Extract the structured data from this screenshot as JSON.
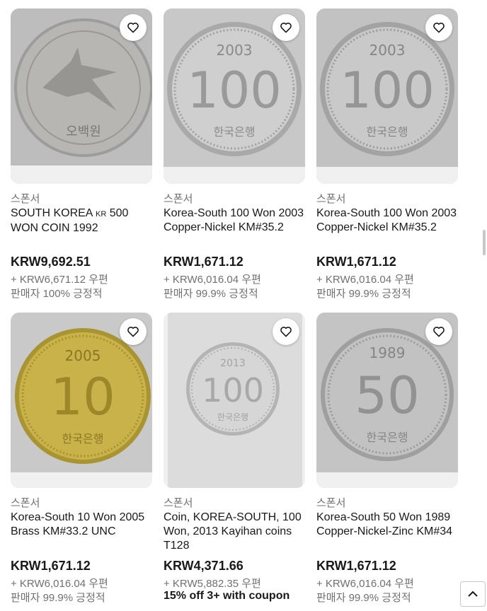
{
  "listings": [
    {
      "sponsored": "스폰서",
      "title_main": "SOUTH KOREA ",
      "title_kr": "KR",
      "title_rest": " 500 WON COIN 1992",
      "price": "KRW9,692.51",
      "shipping": "+ KRW6,671.12 우편",
      "seller": "판매자 100% 긍정적",
      "coin_label": "오백원",
      "wishlist_icon": "heart-icon"
    },
    {
      "sponsored": "스폰서",
      "title": "Korea-South 100 Won 2003 Copper-Nickel KM#35.2",
      "price": "KRW1,671.12",
      "shipping": "+ KRW6,016.04 우편",
      "seller": "판매자 99.9% 긍정적",
      "coin_year": "2003",
      "coin_value": "100",
      "coin_label": "한국은행",
      "wishlist_icon": "heart-icon"
    },
    {
      "sponsored": "스폰서",
      "title": "Korea-South 100 Won 2003 Copper-Nickel KM#35.2",
      "price": "KRW1,671.12",
      "shipping": "+ KRW6,016.04 우편",
      "seller": "판매자 99.9% 긍정적",
      "coin_year": "2003",
      "coin_value": "100",
      "coin_label": "한국은행",
      "wishlist_icon": "heart-icon"
    },
    {
      "sponsored": "스폰서",
      "title": "Korea-South 10 Won 2005 Brass KM#33.2 UNC",
      "price": "KRW1,671.12",
      "shipping": "+ KRW6,016.04 우편",
      "seller": "판매자 99.9% 긍정적",
      "coin_year": "2005",
      "coin_value": "10",
      "coin_label": "한국은행",
      "wishlist_icon": "heart-icon"
    },
    {
      "sponsored": "스폰서",
      "title": "Coin, KOREA-SOUTH, 100 Won, 2013 Kayihan coins T128",
      "price": "KRW4,371.66",
      "shipping": "+ KRW5,882.35 우편",
      "coupon": "15% off 3+ with coupon",
      "coin_year": "2013",
      "coin_value": "100",
      "coin_label": "한국은행",
      "wishlist_icon": "heart-icon"
    },
    {
      "sponsored": "스폰서",
      "title": "Korea-South 50 Won 1989 Copper-Nickel-Zinc KM#34",
      "price": "KRW1,671.12",
      "shipping": "+ KRW6,016.04 우편",
      "seller": "판매자 99.9% 긍정적",
      "coin_year": "1989",
      "coin_value": "50",
      "coin_label": "한국은행",
      "wishlist_icon": "heart-icon"
    }
  ],
  "colors": {
    "text_primary": "#191919",
    "text_secondary": "#707070",
    "image_bg": "#f0f0f0",
    "brass": "#c9b24a",
    "nickel": "#b4b4b4"
  },
  "back_to_top_icon": "chevron-up-icon"
}
